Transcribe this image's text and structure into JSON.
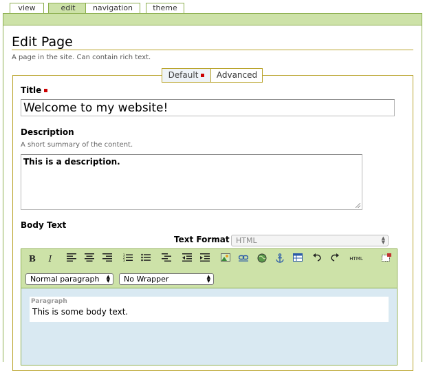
{
  "tabs": {
    "view": "view",
    "edit": "edit",
    "navigation": "navigation",
    "theme": "theme"
  },
  "page": {
    "title": "Edit Page",
    "description": "A page in the site. Can contain rich text."
  },
  "form_tabs": {
    "default": "Default",
    "advanced": "Advanced"
  },
  "fields": {
    "title_label": "Title",
    "title_value": "Welcome to my website!",
    "description_label": "Description",
    "description_hint": "A short summary of the content.",
    "description_value": "This is a description.",
    "body_label": "Body Text",
    "text_format_label": "Text Format",
    "text_format_value": "HTML"
  },
  "editor": {
    "bold": "B",
    "italic": "I",
    "html": "HTML",
    "paragraph_style": "Normal paragraph",
    "wrapper": "No Wrapper",
    "block_label": "Paragraph",
    "body_value": "This is some body text."
  },
  "colors": {
    "accent_green": "#cde2a8",
    "border_green": "#8cae4e",
    "rule_gold": "#b9a32a",
    "required_red": "#cc0000"
  }
}
